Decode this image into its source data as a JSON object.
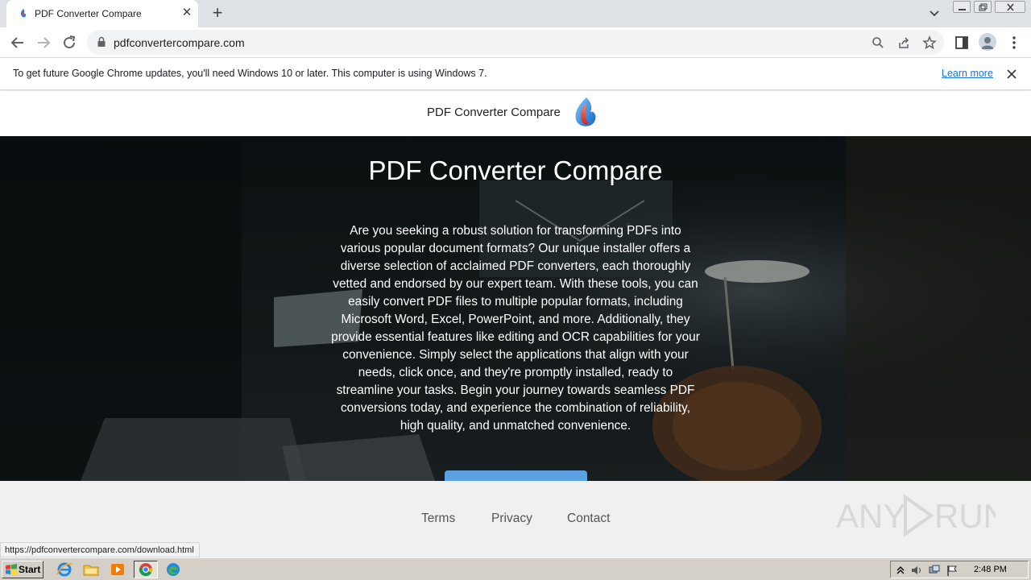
{
  "browser": {
    "tab": {
      "title": "PDF Converter Compare",
      "close_glyph": "✕"
    },
    "new_tab_glyph": "+",
    "address_bar": {
      "url": "pdfconvertercompare.com"
    },
    "infobar": {
      "message": "To get future Google Chrome updates, you'll need Windows 10 or later. This computer is using Windows 7.",
      "link": "Learn more"
    },
    "status_url": "https://pdfconvertercompare.com/download.html"
  },
  "site": {
    "brand": "PDF Converter Compare",
    "hero": {
      "title": "PDF Converter Compare",
      "description": "Are you seeking a robust solution for transforming PDFs into various popular document formats? Our unique installer offers a diverse selection of acclaimed PDF converters, each thoroughly vetted and endorsed by our expert team. With these tools, you can easily convert PDF files to multiple popular formats, including Microsoft Word, Excel, PowerPoint, and more. Additionally, they provide essential features like editing and OCR capabilities for your convenience. Simply select the applications that align with your needs, click once, and they're promptly installed, ready to streamline your tasks. Begin your journey towards seamless PDF conversions today, and experience the combination of reliability, high quality, and unmatched convenience."
    },
    "footer": {
      "links": [
        "Terms",
        "Privacy",
        "Contact"
      ],
      "watermark": "ANY RUN"
    }
  },
  "taskbar": {
    "start_label": "Start",
    "clock": "2:48 PM"
  },
  "colors": {
    "accent_link": "#1a73e8",
    "hero_button": "#5aa1e3",
    "hero_dark": "#1a2224",
    "footer_bg": "#f0f0f0",
    "taskbar": "#d4d0c8"
  },
  "icons": {
    "tab_favicon": "flame-logo-icon",
    "brand_logo": "flame-logo-icon",
    "toolbar": [
      "back-arrow-icon",
      "forward-arrow-icon",
      "reload-icon",
      "lock-icon",
      "search-icon",
      "share-icon",
      "star-icon",
      "side-panel-icon",
      "profile-icon",
      "kebab-menu-icon"
    ],
    "taskbar": [
      "windows-logo-icon",
      "internet-explorer-icon",
      "folder-icon",
      "media-player-icon",
      "chrome-icon",
      "edge-icon"
    ],
    "tray": [
      "show-hidden-icons-icon",
      "volume-icon",
      "network-icon",
      "action-center-flag-icon"
    ]
  }
}
